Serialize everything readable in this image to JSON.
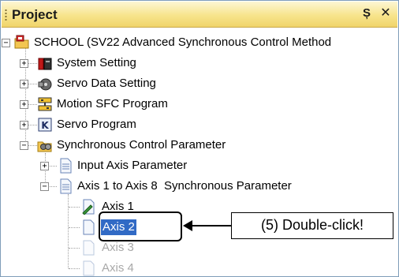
{
  "panel": {
    "title": "Project",
    "pin_glyph": "Ș",
    "close_glyph": "✕"
  },
  "tree": {
    "root": {
      "label": "SCHOOL (SV22 Advanced Synchronous Control Method",
      "expander": "−",
      "icon": "folder-project-icon"
    },
    "items": [
      {
        "label": "System Setting",
        "expander": "+",
        "icon": "system-setting-icon"
      },
      {
        "label": "Servo Data Setting",
        "expander": "+",
        "icon": "servo-data-icon"
      },
      {
        "label": "Motion SFC Program",
        "expander": "+",
        "icon": "sfc-program-icon"
      },
      {
        "label": "Servo Program",
        "expander": "+",
        "icon": "servo-program-icon"
      },
      {
        "label": "Synchronous Control Parameter",
        "expander": "−",
        "icon": "sync-param-folder-icon"
      }
    ],
    "sync_children": [
      {
        "label": "Input Axis Parameter",
        "expander": "+",
        "icon": "document-icon"
      },
      {
        "label": "Axis 1 to Axis 8  Synchronous Parameter",
        "expander": "−",
        "icon": "document-icon"
      }
    ],
    "axes": [
      {
        "label": "Axis 1",
        "state": "edited"
      },
      {
        "label": "Axis 2",
        "state": "selected"
      },
      {
        "label": "Axis 3",
        "state": "disabled"
      },
      {
        "label": "Axis 4",
        "state": "disabled"
      }
    ]
  },
  "annotation": {
    "text": "(5) Double-click!"
  },
  "colors": {
    "title_bar": "#f7e48c",
    "selection": "#316ac5",
    "disabled_text": "#a8a8a8"
  }
}
